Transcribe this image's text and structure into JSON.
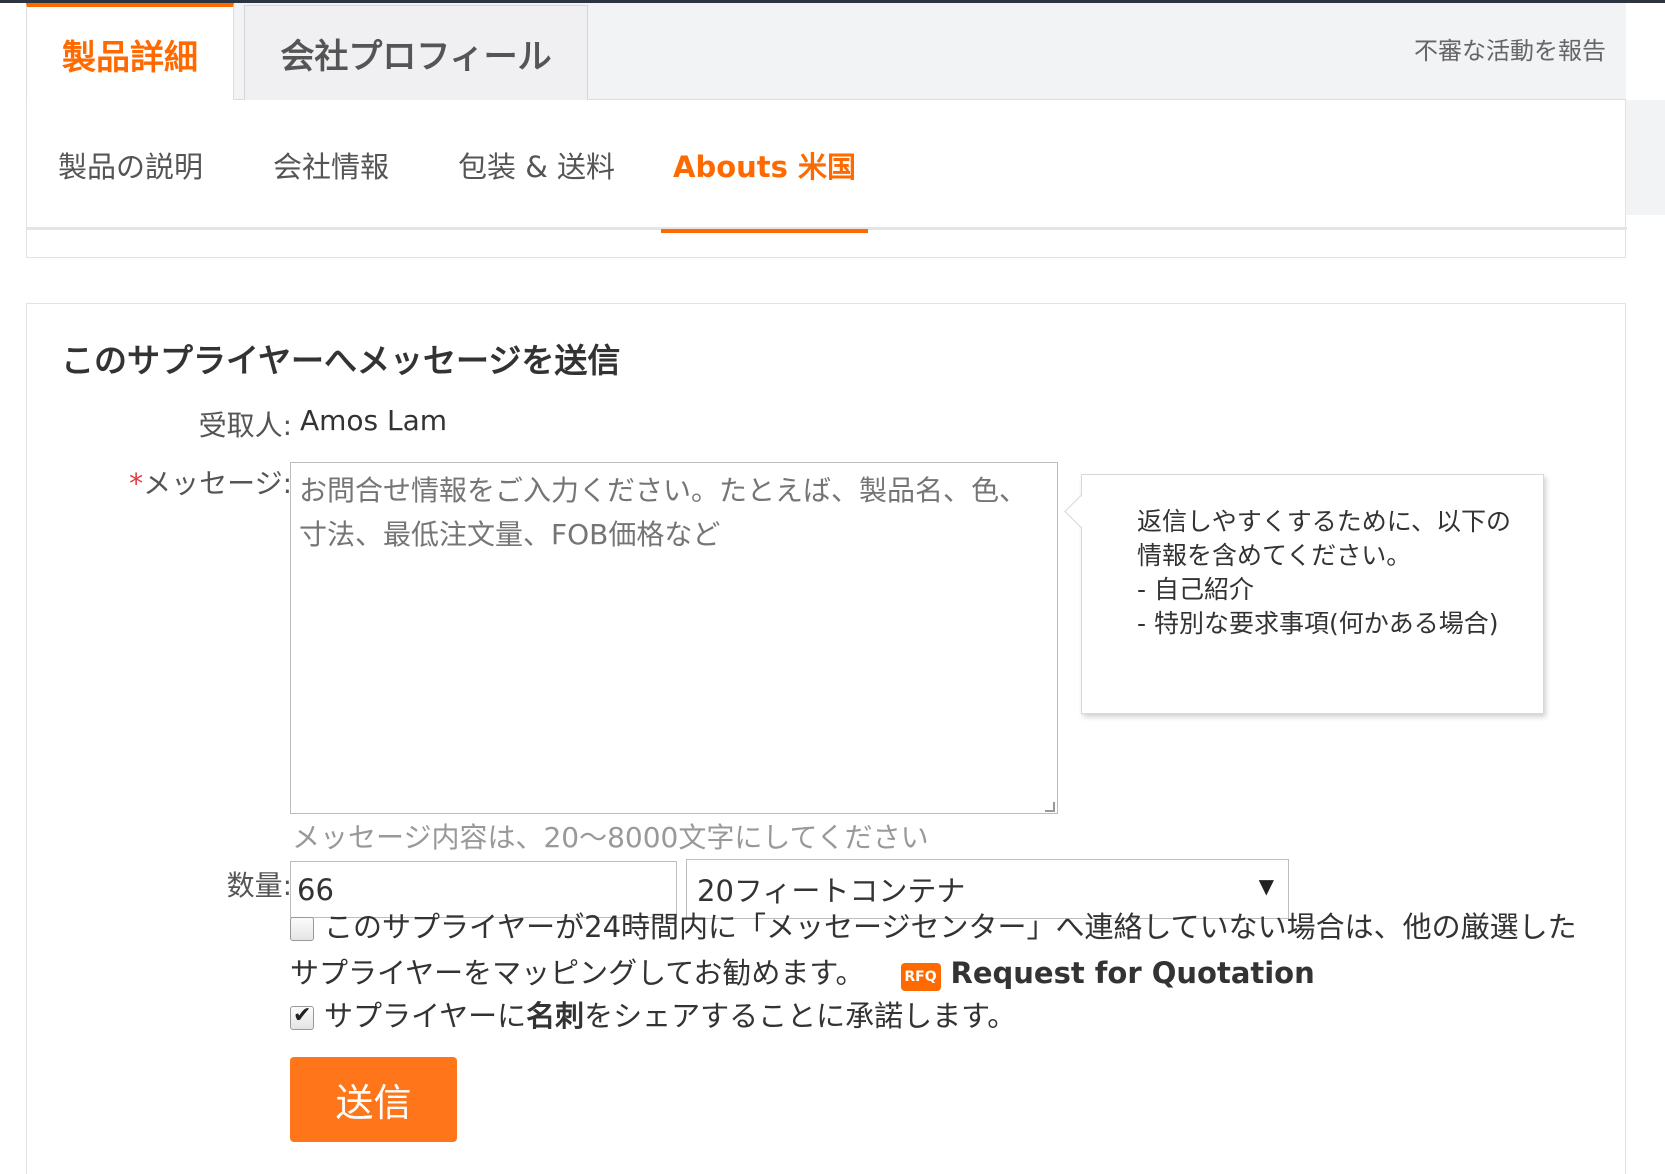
{
  "top_tabs": {
    "product_details": "製品詳細",
    "company_profile": "会社プロフィール",
    "report": "不審な活動を報告"
  },
  "sub_tabs": [
    {
      "label": "製品の説明"
    },
    {
      "label": "会社情報"
    },
    {
      "label": "包装 & 送料"
    },
    {
      "label": "Abouts 米国"
    }
  ],
  "message_form": {
    "title": "このサプライヤーへメッセージを送信",
    "recipient_label": "受取人:",
    "recipient_name": "Amos Lam",
    "required_mark": "*",
    "message_label": "メッセージ:",
    "message_placeholder": "お問合せ情報をご入力ください。たとえば、製品名、色、寸法、最低注文量、FOB価格など",
    "tip_lines": [
      "返信しやすくするために、以下の情報を含めてください。",
      "- 自己紹介",
      "- 特別な要求事項(何かある場合)"
    ],
    "length_hint": "メッセージ内容は、20〜8000文字にしてください",
    "quantity_label": "数量:",
    "quantity_value": "66",
    "unit_selected": "20フィートコンテナ",
    "unit_arrow": "▼",
    "mapping_text_line1": "このサプライヤーが24時間内に「メッセージセンター」へ連絡していない場合は、他の厳選した",
    "mapping_text_line2": "サプライヤーをマッピングしてお勧めます。",
    "rfq_badge": "RFQ",
    "rfq_label": "Request for Quotation",
    "share_text_before": "サプライヤーに",
    "share_text_bold": "名刺",
    "share_text_after": "をシェアすることに承諾します。",
    "send_label": "送信"
  },
  "colors": {
    "accent": "#ff6a00",
    "button": "#ff7519",
    "required": "#e4393c"
  }
}
